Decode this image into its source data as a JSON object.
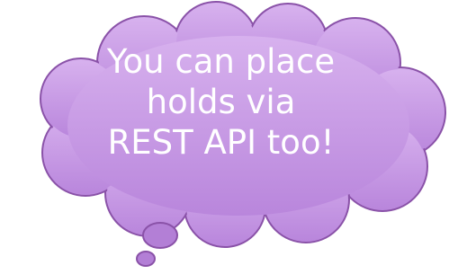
{
  "bubble": {
    "lines": [
      "You can place",
      "holds via",
      "REST API too!"
    ],
    "fill_color": "#c99be6",
    "outline_color": "#8a52a8",
    "text_color": "#ffffff"
  }
}
